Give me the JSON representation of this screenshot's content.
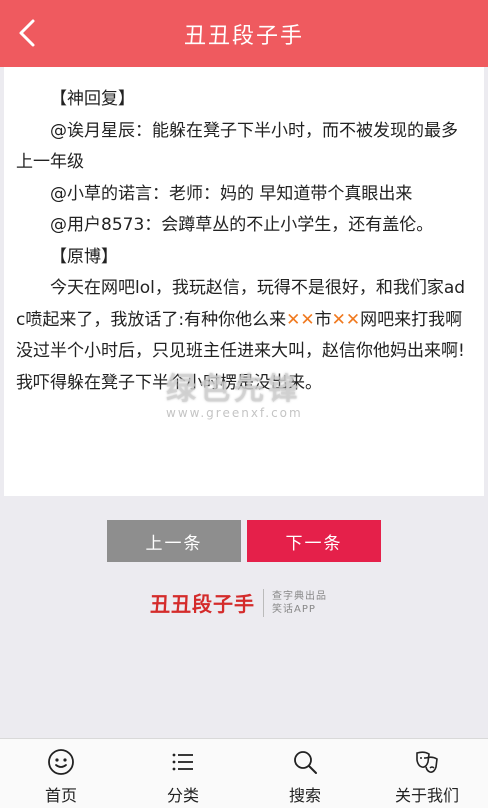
{
  "header": {
    "title": "丑丑段子手"
  },
  "content": {
    "lines": [
      "【神回复】",
      "@诶月星辰：能躲在凳子下半小时，而不被发现的最多上一年级",
      "@小草的诺言：老师：妈的 早知道带个真眼出来",
      "@用户8573：会蹲草丛的不止小学生，还有盖伦。",
      "【原博】"
    ],
    "story_part1": "今天在网吧lol，我玩赵信，玩得不是很好，和我们家adc喷起来了，我放话了:有种你他么来",
    "story_part2": "市",
    "story_part3": "网吧来打我啊没过半个小时后，只见班主任进来大叫，赵信你他妈出来啊!我吓得躲在凳子下半个小时楞是没出来。",
    "redact_mark": "✕"
  },
  "watermark": {
    "main": "绿色先锋",
    "url": "www.greenxf.com"
  },
  "buttons": {
    "prev": "上一条",
    "next": "下一条"
  },
  "brand": {
    "logo": "丑丑段子手",
    "sub1": "查字典出品",
    "sub2": "笑话APP"
  },
  "tabs": [
    {
      "label": "首页",
      "icon": "smiley-icon"
    },
    {
      "label": "分类",
      "icon": "list-icon"
    },
    {
      "label": "搜索",
      "icon": "search-icon"
    },
    {
      "label": "关于我们",
      "icon": "theater-masks-icon"
    }
  ]
}
